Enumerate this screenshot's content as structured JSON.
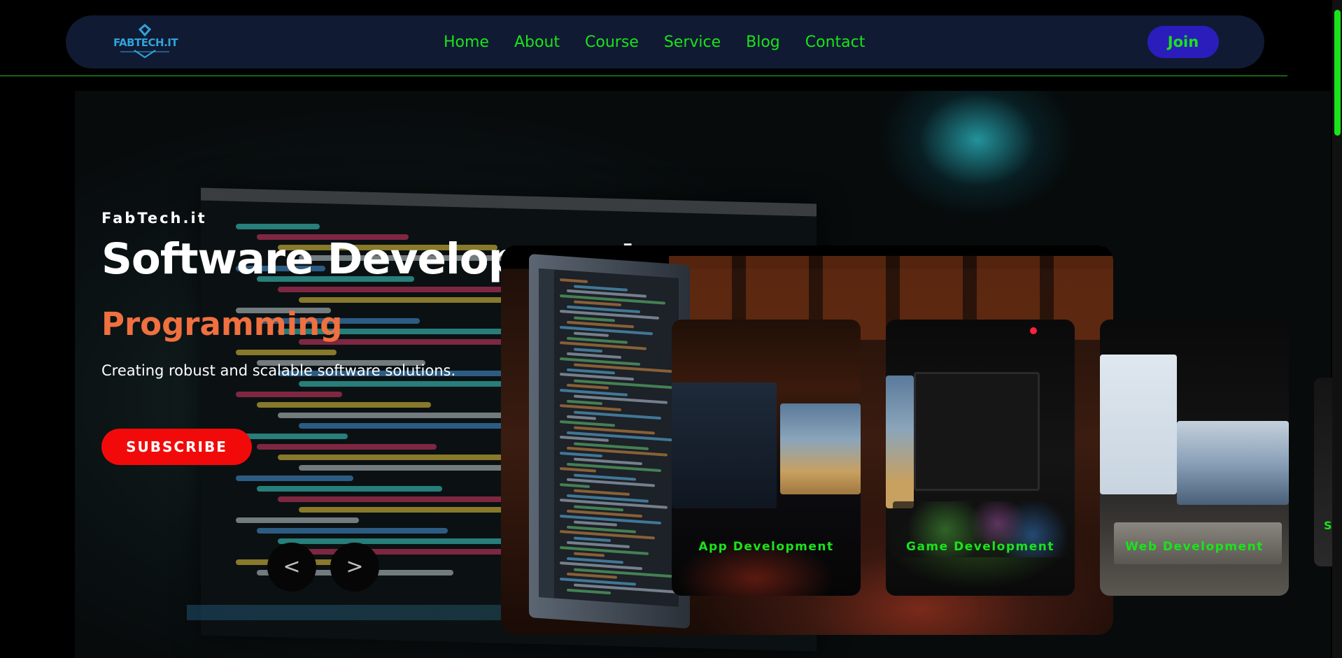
{
  "nav": {
    "logo_text": "FABTECH.IT",
    "links": [
      "Home",
      "About",
      "Course",
      "Service",
      "Blog",
      "Contact"
    ],
    "join_label": "Join"
  },
  "hero": {
    "brand": "FabTech.it",
    "title": "Software Development",
    "subtitle": "Programming",
    "description": "Creating robust and scalable software solutions.",
    "subscribe_label": "SUBSCRIBE",
    "prev_label": "<",
    "next_label": ">"
  },
  "cards": [
    {
      "label": "App Development"
    },
    {
      "label": "Game Development"
    },
    {
      "label": "Web Development"
    }
  ],
  "peek_card_label": "S",
  "colors": {
    "accent_green": "#19e41a",
    "nav_bg": "#111a33",
    "join_bg": "#2b1dbb",
    "subscribe_bg": "#f20a0a",
    "subtitle_orange": "#f07040"
  }
}
